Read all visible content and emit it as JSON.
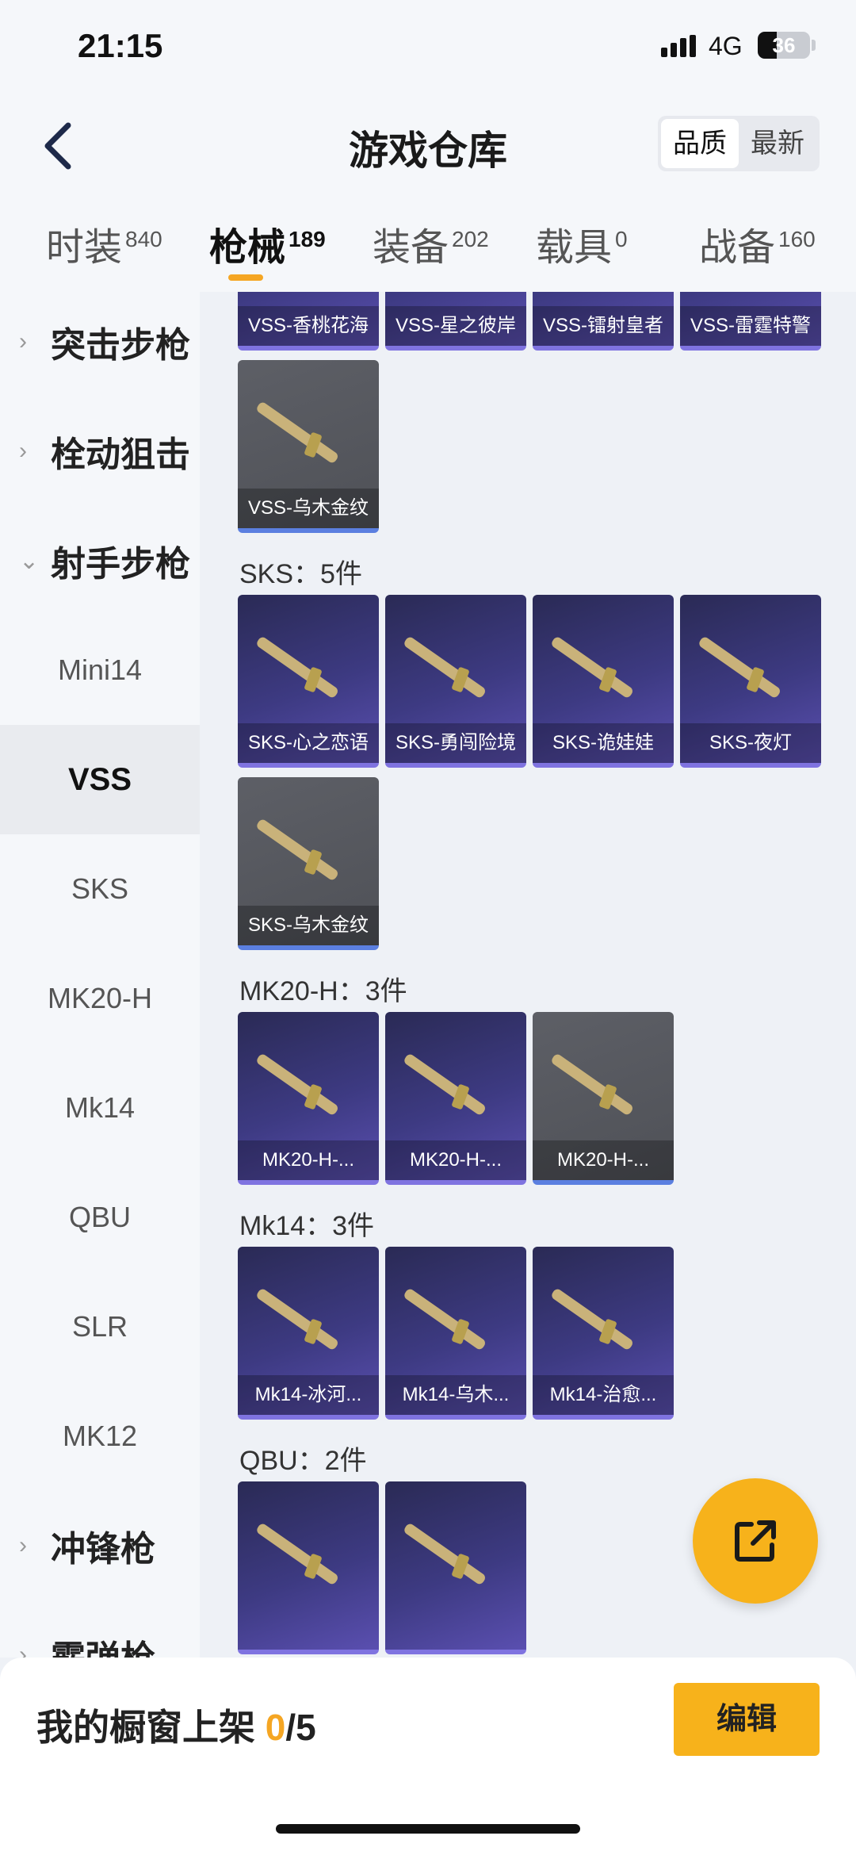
{
  "status": {
    "time": "21:15",
    "network": "4G",
    "battery": "36",
    "battery_level": 0.36
  },
  "header": {
    "title": "游戏仓库",
    "sort_options": [
      "品质",
      "最新"
    ],
    "sort_active": 0
  },
  "categories": [
    {
      "label": "时装",
      "count": "840"
    },
    {
      "label": "枪械",
      "count": "189"
    },
    {
      "label": "装备",
      "count": "202"
    },
    {
      "label": "载具",
      "count": "0"
    },
    {
      "label": "战备",
      "count": "160"
    }
  ],
  "active_category": 1,
  "sidebar": {
    "items": [
      {
        "label": "突击步枪",
        "type": "group",
        "expanded": false
      },
      {
        "label": "栓动狙击",
        "type": "group",
        "expanded": false
      },
      {
        "label": "射手步枪",
        "type": "group",
        "expanded": true
      },
      {
        "label": "Mini14",
        "type": "sub"
      },
      {
        "label": "VSS",
        "type": "sub",
        "active": true
      },
      {
        "label": "SKS",
        "type": "sub"
      },
      {
        "label": "MK20-H",
        "type": "sub"
      },
      {
        "label": "Mk14",
        "type": "sub"
      },
      {
        "label": "QBU",
        "type": "sub"
      },
      {
        "label": "SLR",
        "type": "sub"
      },
      {
        "label": "MK12",
        "type": "sub"
      },
      {
        "label": "冲锋枪",
        "type": "group",
        "expanded": false
      },
      {
        "label": "霰弹枪",
        "type": "group",
        "expanded": false
      }
    ]
  },
  "sections": [
    {
      "title": "",
      "items": [
        {
          "label": "VSS-香桃花海",
          "style": "purple"
        },
        {
          "label": "VSS-星之彼岸",
          "style": "purple"
        },
        {
          "label": "VSS-镭射皇者",
          "style": "purple"
        },
        {
          "label": "VSS-雷霆特警",
          "style": "purple"
        },
        {
          "label": "VSS-乌木金纹",
          "style": "gray"
        }
      ]
    },
    {
      "title": "SKS：5件",
      "items": [
        {
          "label": "SKS-心之恋语",
          "style": "purple"
        },
        {
          "label": "SKS-勇闯险境",
          "style": "purple"
        },
        {
          "label": "SKS-诡娃娃",
          "style": "purple"
        },
        {
          "label": "SKS-夜灯",
          "style": "purple"
        },
        {
          "label": "SKS-乌木金纹",
          "style": "gray"
        }
      ]
    },
    {
      "title": "MK20-H：3件",
      "items": [
        {
          "label": "MK20-H-...",
          "style": "purple"
        },
        {
          "label": "MK20-H-...",
          "style": "purple"
        },
        {
          "label": "MK20-H-...",
          "style": "gray"
        }
      ]
    },
    {
      "title": "Mk14：3件",
      "items": [
        {
          "label": "Mk14-冰河...",
          "style": "purple"
        },
        {
          "label": "Mk14-乌木...",
          "style": "purple"
        },
        {
          "label": "Mk14-治愈...",
          "style": "purple"
        }
      ]
    },
    {
      "title": "QBU：2件",
      "items": [
        {
          "label": "",
          "style": "purple"
        },
        {
          "label": "",
          "style": "purple"
        }
      ]
    }
  ],
  "fab": {
    "icon": "share-icon"
  },
  "bottom": {
    "text": "我的橱窗上架 ",
    "count": "0",
    "total": "/5",
    "edit_label": "编辑"
  },
  "colors": {
    "accent": "#f7b21b",
    "card_purple": "#3d3a82",
    "card_gray": "#55575d"
  }
}
